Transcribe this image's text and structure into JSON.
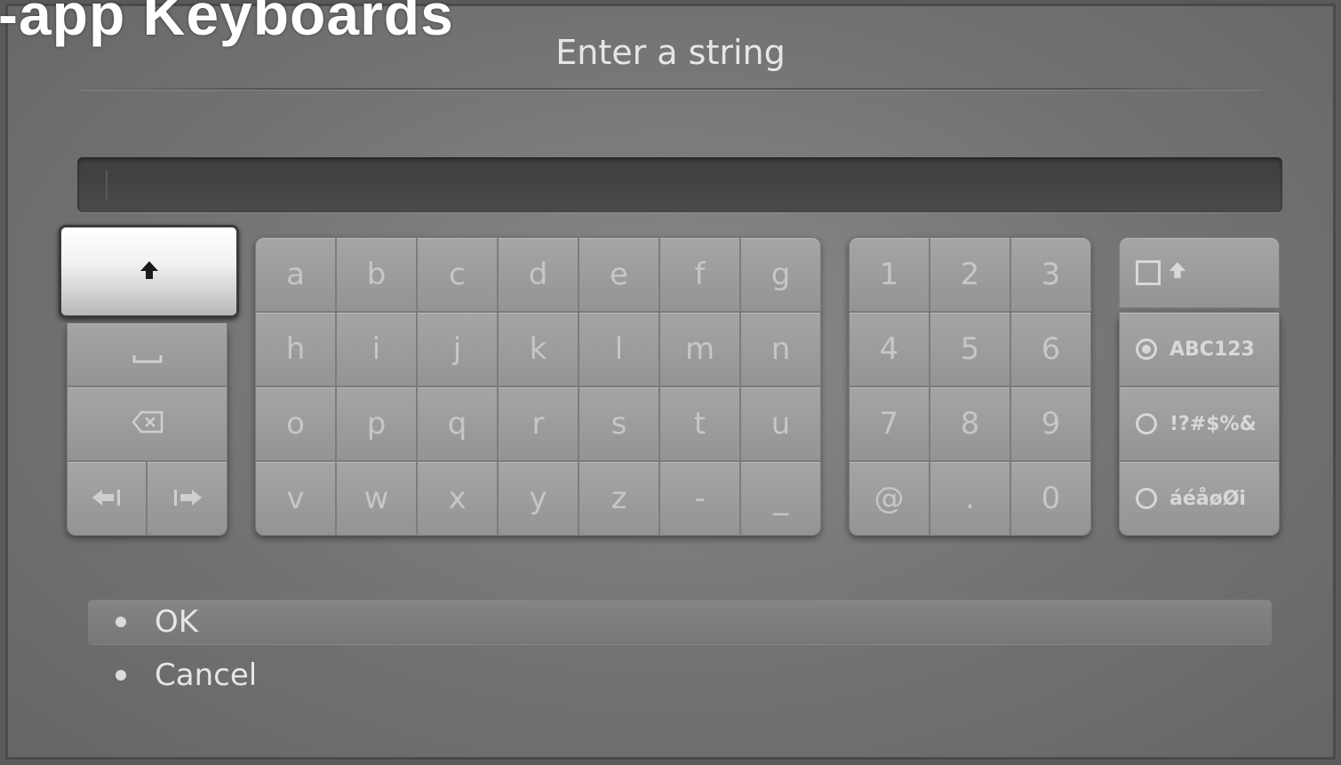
{
  "slide": {
    "title": "-app Keyboards"
  },
  "dialog": {
    "title": "Enter a string",
    "text_value": ""
  },
  "keyboard": {
    "letters": [
      [
        "a",
        "b",
        "c",
        "d",
        "e",
        "f",
        "g"
      ],
      [
        "h",
        "i",
        "j",
        "k",
        "l",
        "m",
        "n"
      ],
      [
        "o",
        "p",
        "q",
        "r",
        "s",
        "t",
        "u"
      ],
      [
        "v",
        "w",
        "x",
        "y",
        "z",
        "-",
        "_"
      ]
    ],
    "numbers": [
      [
        "1",
        "2",
        "3"
      ],
      [
        "4",
        "5",
        "6"
      ],
      [
        "7",
        "8",
        "9"
      ],
      [
        "@",
        ".",
        "0"
      ]
    ],
    "function_keys": {
      "shift_icon": "shift-arrow-icon",
      "space_icon": "space-bar-icon",
      "backspace_icon": "backspace-icon",
      "cursor_left_icon": "cursor-left-icon",
      "cursor_right_icon": "cursor-right-icon"
    },
    "modes": {
      "caps_lock_icon": "shift-arrow-icon",
      "options": [
        {
          "label": "ABC123",
          "selected": true
        },
        {
          "label": "!?#$%&",
          "selected": false
        },
        {
          "label": "áéåøØi",
          "selected": false
        }
      ]
    }
  },
  "actions": [
    {
      "label": "OK",
      "selected": true
    },
    {
      "label": "Cancel",
      "selected": false
    }
  ],
  "colors": {
    "focus_key": "#ffffff",
    "key": "#9e9e9e",
    "key_text": "#c6c6c6",
    "text_field": "#444444"
  }
}
